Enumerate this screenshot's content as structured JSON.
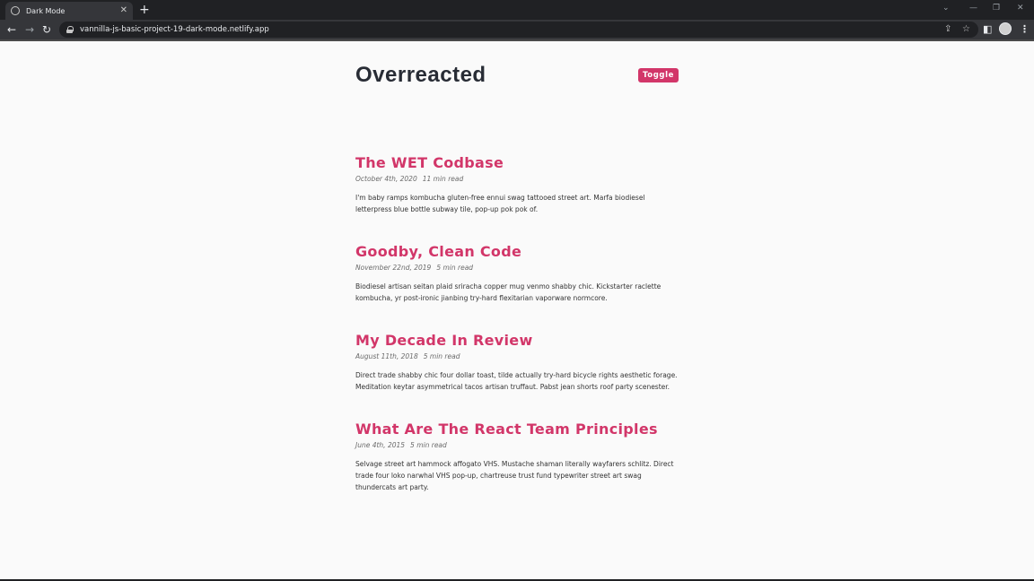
{
  "browser": {
    "tab_title": "Dark Mode",
    "tab_close": "✕",
    "new_tab": "+",
    "url": "vannilla-js-basic-project-19-dark-mode.netlify.app",
    "icons": {
      "back": "arrow-left-icon",
      "forward": "arrow-right-icon",
      "reload": "reload-icon",
      "share": "share-icon",
      "bookmark": "star-icon",
      "sidepanel": "side-panel-icon",
      "profile": "avatar",
      "menu": "kebab-menu-icon"
    },
    "colors": {
      "tabbar": "#202124",
      "toolbar": "#35363a"
    }
  },
  "page": {
    "site_title": "Overreacted",
    "toggle_label": "Toggle",
    "accent_color": "#d23669",
    "posts": [
      {
        "title": "The WET Codbase",
        "date": "October 4th, 2020",
        "read_time": "11 min read",
        "body": "I'm baby ramps kombucha gluten-free ennui swag tattooed street art. Marfa biodiesel letterpress blue bottle subway tile, pop-up pok pok of."
      },
      {
        "title": "Goodby, Clean Code",
        "date": "November 22nd, 2019",
        "read_time": "5 min read",
        "body": "Biodiesel artisan seitan plaid sriracha copper mug venmo shabby chic. Kickstarter raclette kombucha, yr post-ironic jianbing try-hard flexitarian vaporware normcore."
      },
      {
        "title": "My Decade In Review",
        "date": "August 11th, 2018",
        "read_time": "5 min read",
        "body": "Direct trade shabby chic four dollar toast, tilde actually try-hard bicycle rights aesthetic forage. Meditation keytar asymmetrical tacos artisan truffaut. Pabst jean shorts roof party scenester."
      },
      {
        "title": "What Are The React Team Principles",
        "date": "June 4th, 2015",
        "read_time": "5 min read",
        "body": "Selvage street art hammock affogato VHS. Mustache shaman literally wayfarers schlitz. Direct trade four loko narwhal VHS pop-up, chartreuse trust fund typewriter street art swag thundercats art party."
      }
    ]
  }
}
